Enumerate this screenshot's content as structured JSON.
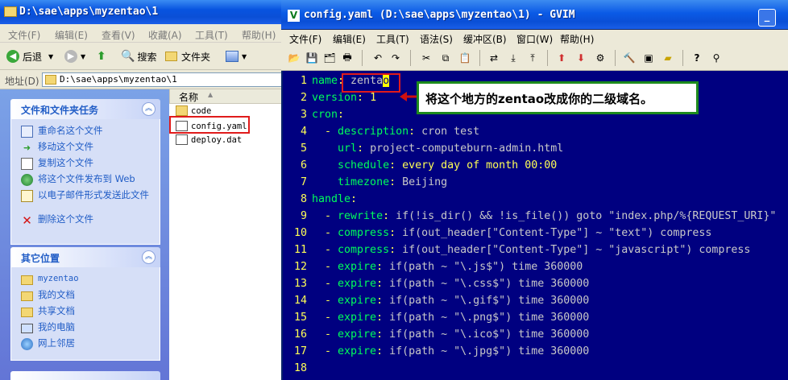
{
  "explorer": {
    "title": "D:\\sae\\apps\\myzentao\\1",
    "menu": [
      "文件(F)",
      "编辑(E)",
      "查看(V)",
      "收藏(A)",
      "工具(T)",
      "帮助(H)"
    ],
    "toolbar": {
      "back": "后退",
      "search": "搜索",
      "folders": "文件夹"
    },
    "address_label": "地址(D)",
    "address_value": "D:\\sae\\apps\\myzentao\\1",
    "tasks_panel": {
      "title": "文件和文件夹任务",
      "items": [
        "重命名这个文件",
        "移动这个文件",
        "复制这个文件",
        "将这个文件发布到 Web",
        "以电子邮件形式发送此文件",
        "删除这个文件"
      ]
    },
    "places_panel": {
      "title": "其它位置",
      "items": [
        "myzentao",
        "我的文档",
        "共享文档",
        "我的电脑",
        "网上邻居"
      ]
    },
    "column_header": "名称",
    "files": [
      "code",
      "config.yaml",
      "deploy.dat"
    ]
  },
  "gvim": {
    "title": "config.yaml (D:\\sae\\apps\\myzentao\\1) - GVIM",
    "menu": [
      "文件(F)",
      "编辑(E)",
      "工具(T)",
      "语法(S)",
      "缓冲区(B)",
      "窗口(W)",
      "帮助(H)"
    ],
    "cursor_char": "o",
    "lines": [
      {
        "n": "1",
        "key": "name",
        "val": "zenta"
      },
      {
        "n": "2",
        "key": "version",
        "val": "1"
      },
      {
        "n": "3",
        "key": "cron",
        "val": ""
      },
      {
        "n": "4",
        "key": "description",
        "val": "cron test"
      },
      {
        "n": "5",
        "key": "url",
        "val": "project-computeburn-admin.html"
      },
      {
        "n": "6",
        "key": "schedule",
        "val": "every day of month 00:00"
      },
      {
        "n": "7",
        "key": "timezone",
        "val": "Beijing"
      },
      {
        "n": "8",
        "key": "handle",
        "val": ""
      },
      {
        "n": "9",
        "key": "rewrite",
        "val": "if(!is_dir() && !is_file()) goto \"index.php/%{REQUEST_URI}\""
      },
      {
        "n": "10",
        "key": "compress",
        "val": "if(out_header[\"Content-Type\"] ~ \"text\") compress"
      },
      {
        "n": "11",
        "key": "compress",
        "val": "if(out_header[\"Content-Type\"] ~ \"javascript\") compress"
      },
      {
        "n": "12",
        "key": "expire",
        "val": "if(path ~ \"\\.js$\") time 360000"
      },
      {
        "n": "13",
        "key": "expire",
        "val": "if(path ~ \"\\.css$\") time 360000"
      },
      {
        "n": "14",
        "key": "expire",
        "val": "if(path ~ \"\\.gif$\") time 360000"
      },
      {
        "n": "15",
        "key": "expire",
        "val": "if(path ~ \"\\.png$\") time 360000"
      },
      {
        "n": "16",
        "key": "expire",
        "val": "if(path ~ \"\\.ico$\") time 360000"
      },
      {
        "n": "17",
        "key": "expire",
        "val": "if(path ~ \"\\.jpg$\") time 360000"
      },
      {
        "n": "18",
        "key": "",
        "val": ""
      }
    ]
  },
  "annotation": {
    "text": "将这个地方的zentao改成你的二级域名。"
  }
}
